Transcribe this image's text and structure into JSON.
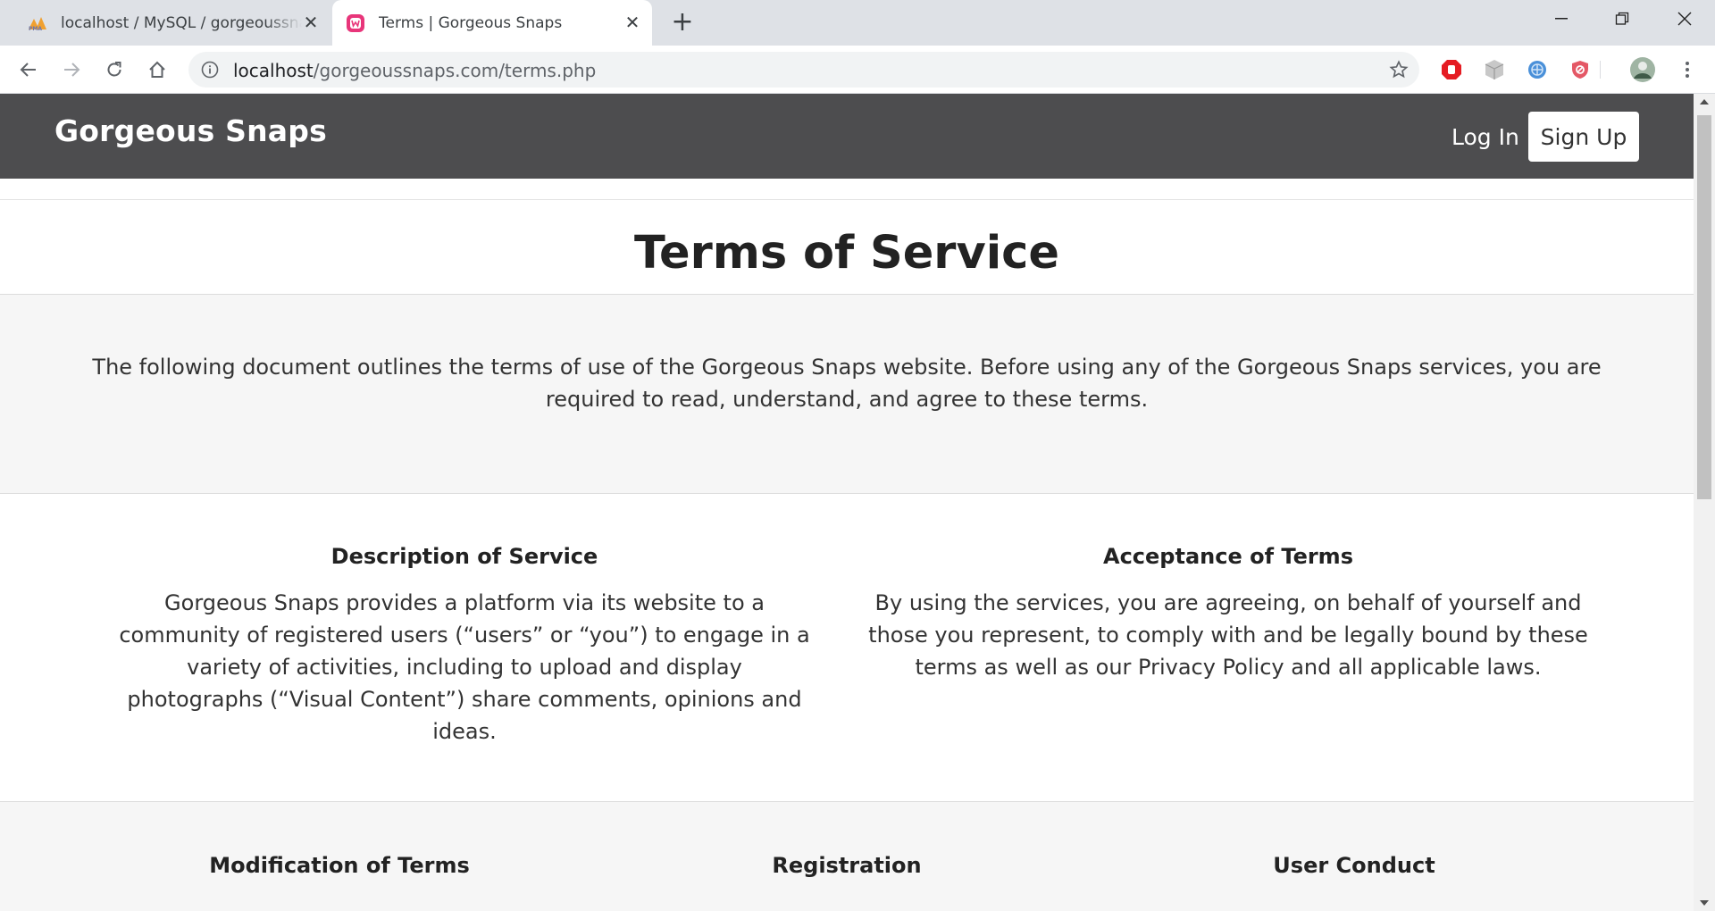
{
  "browser": {
    "tabs": [
      {
        "title": "localhost / MySQL / gorgeoussnaps",
        "favicon": "phpmyadmin-icon",
        "active": false
      },
      {
        "title": "Terms | Gorgeous Snaps",
        "favicon": "wamp-icon",
        "active": true
      }
    ],
    "address": {
      "host": "localhost",
      "path": "/gorgeoussnaps.com/terms.php"
    },
    "extensions": [
      "adblock-icon",
      "cube-icon",
      "globe-icon",
      "shield-icon"
    ]
  },
  "site": {
    "brand": "Gorgeous Snaps",
    "nav": {
      "login": "Log In",
      "signup": "Sign Up"
    }
  },
  "page": {
    "title": "Terms of Service",
    "intro": "The following document outlines the terms of use of the Gorgeous Snaps website. Before using any of the Gorgeous Snaps services, you are required to read, understand, and agree to these terms.",
    "sections": [
      {
        "heading": "Description of Service",
        "body": "Gorgeous Snaps provides a platform via its website to a community of registered users (“users” or “you”) to engage in a variety of activities, including to upload and display photographs (“Visual Content”) share comments, opinions and ideas."
      },
      {
        "heading": "Acceptance of Terms",
        "body": "By using the services, you are agreeing, on behalf of yourself and those you represent, to comply with and be legally bound by these terms as well as our Privacy Policy and all applicable laws."
      }
    ],
    "more_sections": [
      "Modification of Terms",
      "Registration",
      "User Conduct"
    ]
  },
  "colors": {
    "navbar": "#4d4d4f",
    "band": "#f6f6f6"
  }
}
